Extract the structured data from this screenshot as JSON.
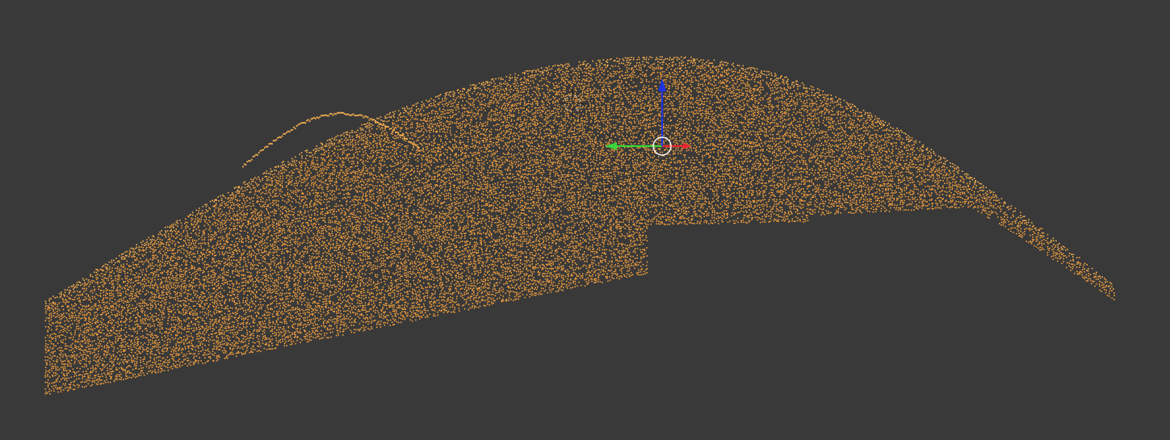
{
  "viewport": {
    "background_color": "#393939",
    "view_mode": "3D viewport",
    "object_type": "point cloud",
    "object_name": "",
    "selected": true
  },
  "point_cloud": {
    "point_color": "#f5a03c",
    "highlight_color": "#ffb450",
    "density": "high"
  },
  "gizmo": {
    "x_axis_color": "#e8242f",
    "y_axis_color": "#3ad53a",
    "z_axis_color": "#1f34e0",
    "pivot_color": "#ffffff"
  },
  "cursor_3d": {
    "icon": "crosshair-icon"
  }
}
